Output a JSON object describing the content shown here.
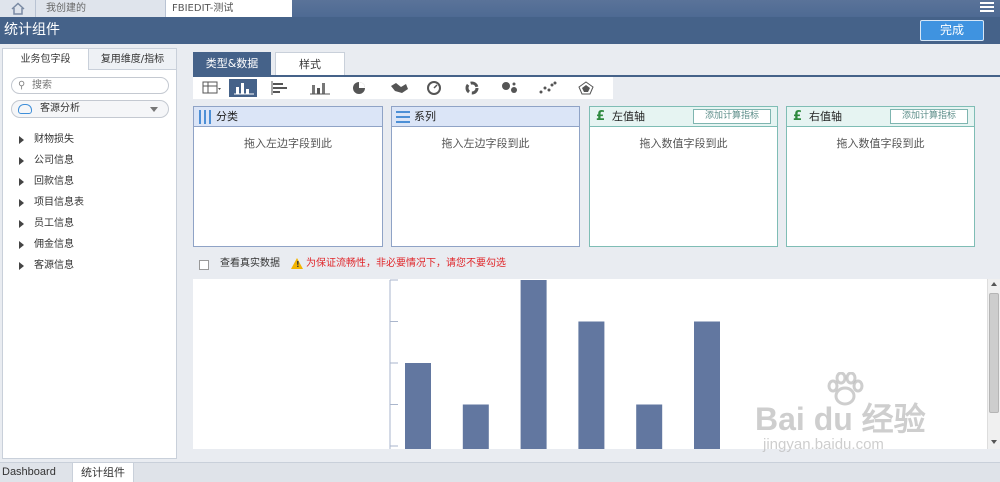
{
  "topbar": {
    "tabs": [
      {
        "label": "我创建的"
      },
      {
        "label": "FBIEDIT-测试"
      }
    ]
  },
  "header": {
    "title": "统计组件",
    "done_label": "完成"
  },
  "left_panel": {
    "tabs": [
      {
        "label": "业务包字段"
      },
      {
        "label": "复用维度/指标"
      }
    ],
    "search_placeholder": "搜索",
    "package_select": "客源分析",
    "fields": [
      {
        "label": "财物损失"
      },
      {
        "label": "公司信息"
      },
      {
        "label": "回款信息"
      },
      {
        "label": "项目信息表"
      },
      {
        "label": "员工信息"
      },
      {
        "label": "佣金信息"
      },
      {
        "label": "客源信息"
      }
    ]
  },
  "main": {
    "tabs": [
      {
        "label": "类型&数据"
      },
      {
        "label": "样式"
      }
    ],
    "drop_boxes": {
      "category": {
        "title": "分类",
        "placeholder": "拖入左边字段到此"
      },
      "series": {
        "title": "系列",
        "placeholder": "拖入左边字段到此"
      },
      "left_axis": {
        "title": "左值轴",
        "placeholder": "拖入数值字段到此",
        "add_button": "添加计算指标"
      },
      "right_axis": {
        "title": "右值轴",
        "placeholder": "拖入数值字段到此",
        "add_button": "添加计算指标"
      }
    },
    "real_data_label": "查看真实数据",
    "warning_text": "为保证流畅性，非必要情况下，请您不要勾选"
  },
  "chart_data": {
    "type": "bar",
    "values": [
      2,
      1,
      4,
      3,
      1,
      3
    ],
    "ylim": [
      0,
      4
    ],
    "color": "#6277a0"
  },
  "watermark": {
    "main": "Bai du 经验",
    "sub": "jingyan.baidu.com"
  },
  "bottom_tabs": [
    {
      "label": "Dashboard"
    },
    {
      "label": "统计组件"
    }
  ],
  "colors": {
    "header": "#456289",
    "done_button": "#3f93e0",
    "accent_teal": "#7fbdb5",
    "accent_blue": "#8fa3c6",
    "warning": "#e0262a"
  }
}
